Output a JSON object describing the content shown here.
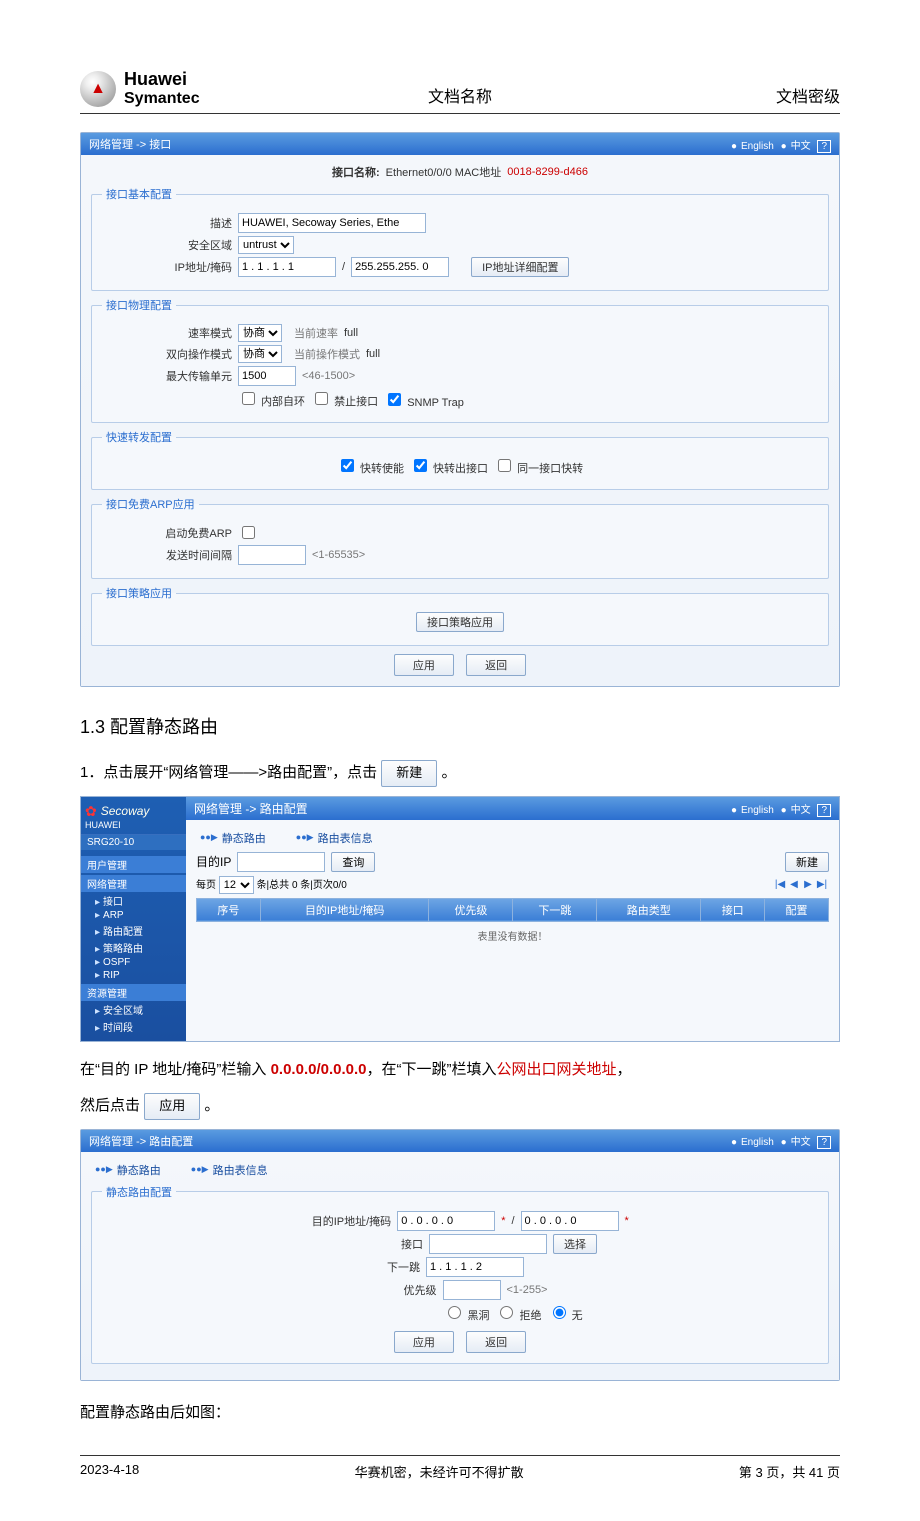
{
  "header": {
    "logo_line1": "Huawei",
    "logo_line2": "Symantec",
    "center": "文档名称",
    "right": "文档密级"
  },
  "scr1": {
    "breadcrumb": "网络管理  -> 接口",
    "lang_en": "English",
    "lang_cn": "中文",
    "help": "?",
    "iface_name_label": "接口名称:",
    "iface_name_value": "Ethernet0/0/0   MAC地址",
    "mac_value": "0018-8299-d466",
    "g_basic": "接口基本配置",
    "desc_label": "描述",
    "desc_value": "HUAWEI, Secoway Series, Ethe",
    "zone_label": "安全区域",
    "zone_value": "untrust",
    "ipmask_label": "IP地址/掩码",
    "ip_value": "1 . 1 . 1 . 1",
    "mask_value": "255.255.255. 0",
    "ipdetail_btn": "IP地址详细配置",
    "g_phys": "接口物理配置",
    "rate_label": "速率模式",
    "rate_value": "协商",
    "rate_cur_label": "当前速率",
    "rate_cur_value": "full",
    "duplex_label": "双向操作模式",
    "duplex_value": "协商",
    "duplex_cur_label": "当前操作模式",
    "duplex_cur_value": "full",
    "mtu_label": "最大传输单元",
    "mtu_value": "1500",
    "mtu_hint": "<46-1500>",
    "chk_loop": "内部自环",
    "chk_disable": "禁止接口",
    "chk_snmp": "SNMP Trap",
    "g_fast": "快速转发配置",
    "chk_fast_en": "快转使能",
    "chk_fast_out": "快转出接口",
    "chk_fast_same": "同一接口快转",
    "g_arp": "接口免费ARP应用",
    "arp_start_label": "启动免费ARP",
    "arp_interval_label": "发送时间间隔",
    "arp_interval_hint": "<1-65535>",
    "g_policy": "接口策略应用",
    "policy_btn": "接口策略应用",
    "apply_btn": "应用",
    "back_btn": "返回"
  },
  "section_title": "1.3 配置静态路由",
  "step1_prefix": "1．点击展开“网络管理——>路由配置”，点击",
  "step1_btn": "新建",
  "step1_suffix": "。",
  "scr2": {
    "side_brand": "Secoway",
    "side_vendor": "HUAWEI",
    "side_device": "SRG20-10",
    "tree": {
      "user_mgmt": "用户管理",
      "net_mgmt": "网络管理",
      "iface": "接口",
      "arp": "ARP",
      "route_cfg": "路由配置",
      "policy_route": "策略路由",
      "ospf": "OSPF",
      "rip": "RIP",
      "res_mgmt": "资源管理",
      "sec_zone": "安全区域",
      "time_seg": "时间段"
    },
    "breadcrumb": "网络管理  -> 路由配置",
    "tab_static": "静态路由",
    "tab_routetable": "路由表信息",
    "dest_ip_label": "目的IP",
    "search_btn": "查询",
    "new_btn": "新建",
    "pager_prefix": "每页",
    "pager_size": "12",
    "pager_info": "条|总共 0 条|页次0/0",
    "col_seq": "序号",
    "col_ipmask": "目的IP地址/掩码",
    "col_pri": "优先级",
    "col_nexthop": "下一跳",
    "col_rtype": "路由类型",
    "col_iface": "接口",
    "col_cfg": "配置",
    "empty": "表里没有数据！"
  },
  "para2_a": "在“目的 IP 地址/掩码”栏输入 ",
  "para2_red1": "0.0.0.0/0.0.0.0",
  "para2_b": "，在“下一跳”栏填入",
  "para2_red2": "公网出口网关地址",
  "para2_c": "，",
  "para3_prefix": "然后点击",
  "para3_btn": "应用",
  "para3_suffix": "。",
  "scr3": {
    "breadcrumb": "网络管理  -> 路由配置",
    "tab_static": "静态路由",
    "tab_routetable": "路由表信息",
    "g_static": "静态路由配置",
    "ipmask_label": "目的IP地址/掩码",
    "ip_value": "0 . 0 . 0 . 0",
    "mask_value": "0 . 0 . 0 . 0",
    "iface_label": "接口",
    "select_btn": "选择",
    "nexthop_label": "下一跳",
    "nexthop_value": "1 . 1 . 1 . 2",
    "pri_label": "优先级",
    "pri_hint": "<1-255>",
    "opt_blackhole": "黑洞",
    "opt_reject": "拒绝",
    "opt_none": "无",
    "apply_btn": "应用",
    "back_btn": "返回"
  },
  "para_after": "配置静态路由后如图：",
  "footer": {
    "date": "2023-4-18",
    "center": "华赛机密，未经许可不得扩散",
    "page": "第 3 页，共 41 页"
  }
}
